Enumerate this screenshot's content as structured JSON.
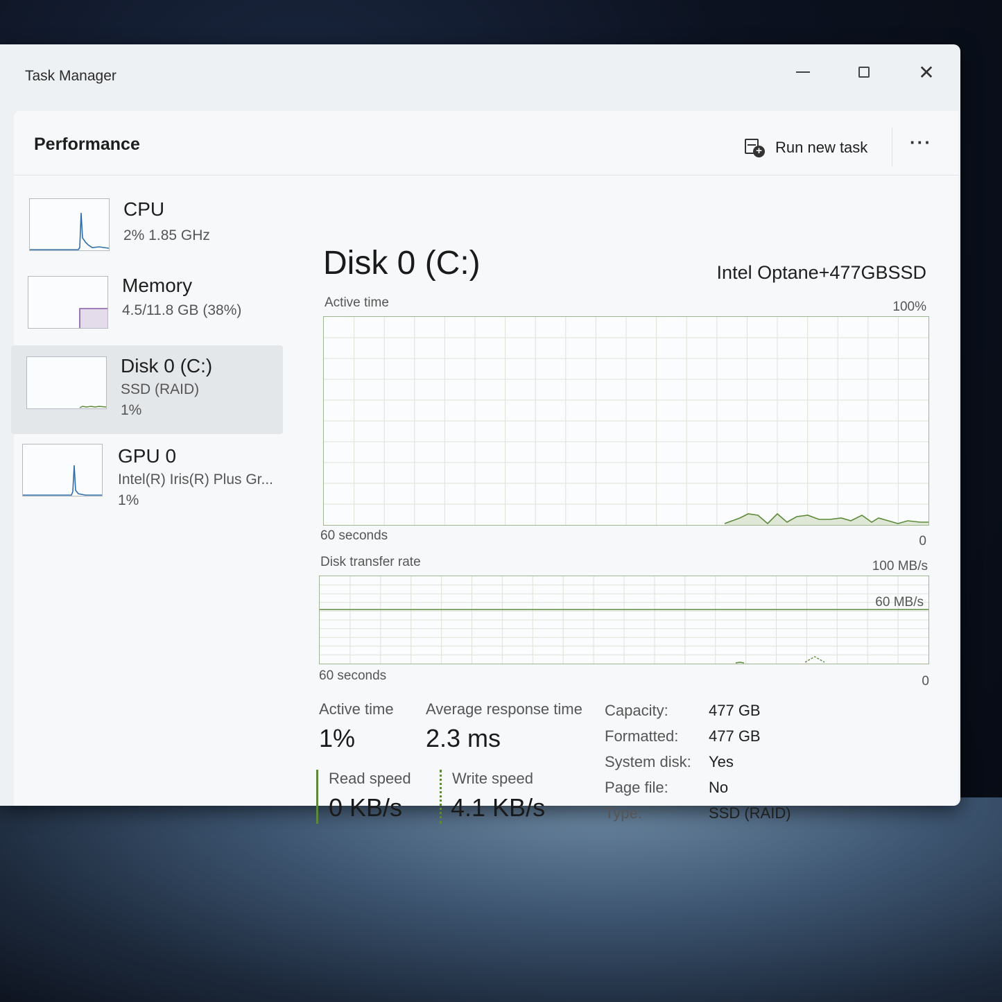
{
  "window": {
    "title": "Task Manager"
  },
  "header": {
    "title": "Performance",
    "run_task_label": "Run new task",
    "more_label": "···"
  },
  "sidebar": {
    "items": [
      {
        "title": "CPU",
        "subtitle": "2%  1.85 GHz",
        "value": ""
      },
      {
        "title": "Memory",
        "subtitle": "4.5/11.8 GB (38%)",
        "value": ""
      },
      {
        "title": "Disk 0 (C:)",
        "subtitle": "SSD (RAID)",
        "value": "1%"
      },
      {
        "title": "GPU 0",
        "subtitle": "Intel(R) Iris(R) Plus Gr...",
        "value": "1%"
      }
    ],
    "selected_index": 2
  },
  "main": {
    "title": "Disk 0 (C:)",
    "model": "Intel Optane+477GBSSD",
    "active_chart": {
      "label": "Active time",
      "max_label": "100%",
      "time_label": "60 seconds",
      "min_label": "0"
    },
    "transfer_chart": {
      "label": "Disk transfer rate",
      "max_label": "100 MB/s",
      "mid_label": "60 MB/s",
      "time_label": "60 seconds",
      "min_label": "0"
    },
    "stats": {
      "active_time_label": "Active time",
      "active_time_value": "1%",
      "response_label": "Average response time",
      "response_value": "2.3 ms",
      "read_label": "Read speed",
      "read_value": "0 KB/s",
      "write_label": "Write speed",
      "write_value": "4.1 KB/s"
    },
    "properties": [
      {
        "label": "Capacity:",
        "value": "477 GB"
      },
      {
        "label": "Formatted:",
        "value": "477 GB"
      },
      {
        "label": "System disk:",
        "value": "Yes"
      },
      {
        "label": "Page file:",
        "value": "No"
      },
      {
        "label": "Type:",
        "value": "SSD (RAID)"
      }
    ]
  },
  "colors": {
    "disk_line": "#5c8a3a",
    "disk_fill": "#dfe8d6",
    "cpu_line": "#2f6ea8",
    "memory_line": "#8a5aa8"
  }
}
